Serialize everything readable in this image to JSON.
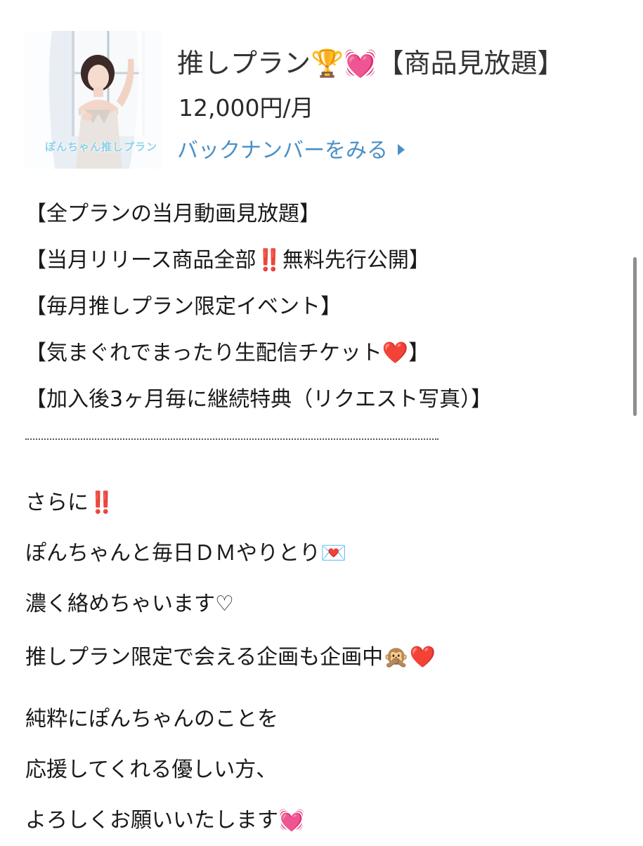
{
  "plan": {
    "title": "推しプラン🏆💓【商品見放題】",
    "price": "12,000円/月",
    "backnumber_label": "バックナンバーをみる",
    "thumbnail_caption": "ぽんちゃん推しプラン"
  },
  "features": [
    "【全プランの当月動画見放題】",
    "【当月リリース商品全部‼️無料先行公開】",
    "【毎月推しプラン限定イベント】",
    "【気まぐれでまったり生配信チケット❤️】",
    "【加入後3ヶ月毎に継続特典（リクエスト写真）】"
  ],
  "message": {
    "block1": [
      "さらに‼️",
      "ぽんちゃんと毎日ＤＭやりとり💌",
      "濃く絡めちゃいます♡"
    ],
    "block2": [
      "推しプラン限定で会える企画も企画中🙊❤️"
    ],
    "block3": [
      "純粋にぽんちゃんのことを",
      "応援してくれる優しい方、",
      "よろしくお願いいたします💓"
    ]
  },
  "colors": {
    "link": "#4a90c6",
    "text": "#1a1a1a",
    "title": "#333333"
  }
}
